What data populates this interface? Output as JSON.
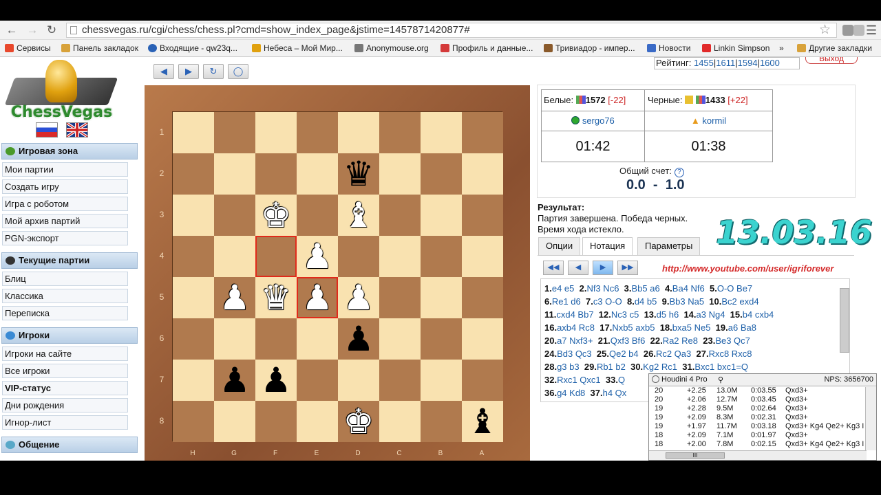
{
  "browser": {
    "url": "chessvegas.ru/cgi/chess/chess.pl?cmd=show_index_page&jstime=1457871420877#",
    "bookmarks": [
      {
        "label": "Сервисы",
        "color": "#e8482c"
      },
      {
        "label": "Панель закладок",
        "color": "#d8a23a"
      },
      {
        "label": "Входящие - qw23q...",
        "color": "#2a62b6"
      },
      {
        "label": "Небеса – Мой Мир...",
        "color": "#e0a10f"
      },
      {
        "label": "Anonymouse.org",
        "color": "#777777"
      },
      {
        "label": "Профиль и данные...",
        "color": "#d43a3a"
      },
      {
        "label": "Тривиадор - импер...",
        "color": "#8a5a2b"
      },
      {
        "label": "Новости",
        "color": "#3a6ac6"
      },
      {
        "label": "Linkin Simpson",
        "color": "#e12a2a"
      },
      {
        "label": "»",
        "color": ""
      },
      {
        "label": "Другие закладки",
        "color": "#d8a23a"
      }
    ]
  },
  "site": {
    "name": "ChessVegas",
    "rating": {
      "label": "Рейтинг:",
      "values": [
        "1455",
        "1611",
        "1594",
        "1600"
      ]
    },
    "logout": "Выход"
  },
  "sidebar": {
    "sections": [
      {
        "title": "Игровая зона",
        "icon_color": "#4a9a2a",
        "items": [
          "Мои партии",
          "Создать игру",
          "Игра с роботом",
          "Мой архив партий",
          "PGN-экспорт"
        ]
      },
      {
        "title": "Текущие партии",
        "icon_color": "#333333",
        "items": [
          "Блиц",
          "Классика",
          "Переписка"
        ]
      },
      {
        "title": "Игроки",
        "icon_color": "#3a8ad4",
        "items": [
          "Игроки на сайте",
          "Все игроки",
          "VIP-статус",
          "Дни рождения",
          "Игнор-лист"
        ]
      },
      {
        "title": "Общение",
        "icon_color": "#58a8c8",
        "items": []
      }
    ]
  },
  "players": {
    "white_label": "Белые:",
    "white_rating": "1572",
    "white_delta": "[-22]",
    "black_label": "Черные:",
    "black_rating": "1433",
    "black_delta": "[+22]",
    "white_name": "sergo76",
    "black_name": "kormil",
    "white_time": "01:42",
    "black_time": "01:38"
  },
  "score": {
    "label": "Общий счет:",
    "help": "?",
    "value": "0.0  -  1.0"
  },
  "result": {
    "title": "Результат:",
    "line1": "Партия завершена. Победа черных.",
    "line2": "Время хода истекло."
  },
  "overlay": {
    "date": "13.03.16",
    "youtube": "http://www.youtube.com/user/igriforever"
  },
  "tabs": [
    "Опции",
    "Нотация",
    "Параметры"
  ],
  "board": {
    "ranks": [
      "1",
      "2",
      "3",
      "4",
      "5",
      "6",
      "7",
      "8"
    ],
    "files": [
      "H",
      "G",
      "F",
      "E",
      "D",
      "C",
      "B",
      "A"
    ],
    "pieces": [
      {
        "name": "black-queen",
        "glyph": "♛",
        "color": "b",
        "row": 1,
        "col": 4
      },
      {
        "name": "white-king",
        "glyph": "♚",
        "color": "w",
        "row": 2,
        "col": 2
      },
      {
        "name": "white-bishop",
        "glyph": "♝",
        "color": "w",
        "row": 2,
        "col": 4
      },
      {
        "name": "white-pawn",
        "glyph": "♟",
        "color": "w",
        "row": 3,
        "col": 3
      },
      {
        "name": "white-pawn",
        "glyph": "♟",
        "color": "w",
        "row": 4,
        "col": 1
      },
      {
        "name": "white-queen",
        "glyph": "♛",
        "color": "w",
        "row": 4,
        "col": 2
      },
      {
        "name": "white-pawn",
        "glyph": "♟",
        "color": "w",
        "row": 4,
        "col": 3
      },
      {
        "name": "white-pawn",
        "glyph": "♟",
        "color": "w",
        "row": 4,
        "col": 4
      },
      {
        "name": "black-pawn",
        "glyph": "♟",
        "color": "b",
        "row": 5,
        "col": 4
      },
      {
        "name": "black-pawn",
        "glyph": "♟",
        "color": "b",
        "row": 6,
        "col": 1
      },
      {
        "name": "black-pawn",
        "glyph": "♟",
        "color": "b",
        "row": 6,
        "col": 2
      },
      {
        "name": "white-king",
        "glyph": "♚",
        "color": "w",
        "row": 7,
        "col": 4
      },
      {
        "name": "black-bishop",
        "glyph": "♝",
        "color": "b",
        "row": 7,
        "col": 7
      }
    ],
    "highlights": [
      {
        "row": 3,
        "col": 2
      },
      {
        "row": 4,
        "col": 3
      }
    ]
  },
  "notation": [
    [
      [
        "1.",
        "e4 e5"
      ],
      [
        "2.",
        "Nf3 Nc6"
      ],
      [
        "3.",
        "Bb5 a6"
      ],
      [
        "4.",
        "Ba4 Nf6"
      ],
      [
        "5.",
        "O-O Be7"
      ]
    ],
    [
      [
        "6.",
        "Re1 d6"
      ],
      [
        "7.",
        "c3 O-O"
      ],
      [
        "8.",
        "d4 b5"
      ],
      [
        "9.",
        "Bb3 Na5"
      ],
      [
        "10.",
        "Bc2 exd4"
      ]
    ],
    [
      [
        "11.",
        "cxd4 Bb7"
      ],
      [
        "12.",
        "Nc3 c5"
      ],
      [
        "13.",
        "d5 h6"
      ],
      [
        "14.",
        "a3 Ng4"
      ],
      [
        "15.",
        "b4 cxb4"
      ]
    ],
    [
      [
        "16.",
        "axb4 Rc8"
      ],
      [
        "17.",
        "Nxb5 axb5"
      ],
      [
        "18.",
        "bxa5 Ne5"
      ],
      [
        "19.",
        "a6 Ba8"
      ]
    ],
    [
      [
        "20.",
        "a7 Nxf3+"
      ],
      [
        "21.",
        "Qxf3 Bf6"
      ],
      [
        "22.",
        "Ra2 Re8"
      ],
      [
        "23.",
        "Be3 Qc7"
      ]
    ],
    [
      [
        "24.",
        "Bd3 Qc3"
      ],
      [
        "25.",
        "Qe2 b4"
      ],
      [
        "26.",
        "Rc2 Qa3"
      ],
      [
        "27.",
        "Rxc8 Rxc8"
      ]
    ],
    [
      [
        "28.",
        "g3 b3"
      ],
      [
        "29.",
        "Rb1 b2"
      ],
      [
        "30.",
        "Kg2 Rc1"
      ],
      [
        "31.",
        "Bxc1 bxc1=Q"
      ]
    ],
    [
      [
        "32.",
        "Rxc1 Qxc1"
      ],
      [
        "33.",
        "Q"
      ]
    ],
    [
      [
        "36.",
        "g4 Kd8"
      ],
      [
        "37.",
        "h4 Qx"
      ]
    ]
  ],
  "engine": {
    "name": "Houdini 4 Pro",
    "nps": "NPS: 3656700",
    "rows": [
      [
        "20",
        "+2.25",
        "13.0M",
        "0:03.55",
        "Qxd3+"
      ],
      [
        "20",
        "+2.06",
        "12.7M",
        "0:03.45",
        "Qxd3+"
      ],
      [
        "19",
        "+2.28",
        "9.5M",
        "0:02.64",
        "Qxd3+"
      ],
      [
        "19",
        "+2.09",
        "8.3M",
        "0:02.31",
        "Qxd3+"
      ],
      [
        "19",
        "+1.97",
        "11.7M",
        "0:03.18",
        "Qxd3+ Kg4 Qe2+ Kg3 I"
      ],
      [
        "18",
        "+2.09",
        "7.1M",
        "0:01.97",
        "Qxd3+"
      ],
      [
        "18",
        "+2.00",
        "7.8M",
        "0:02.15",
        "Qxd3+ Kg4 Qe2+ Kg3 I"
      ]
    ]
  }
}
